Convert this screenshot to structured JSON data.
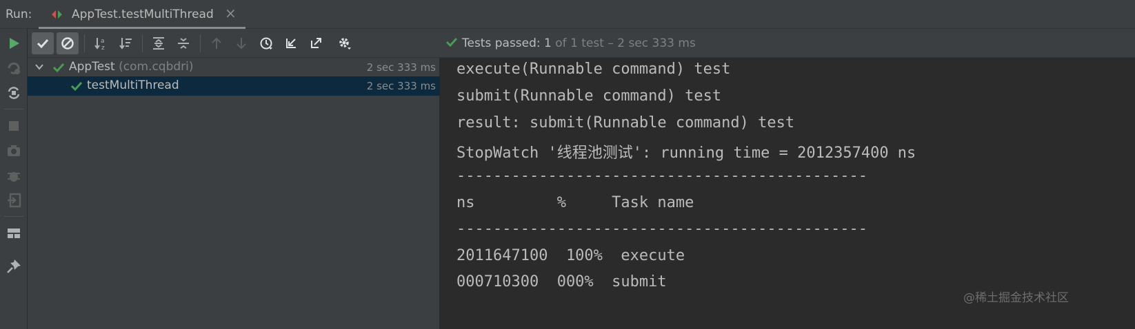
{
  "header": {
    "run_label": "Run:",
    "tab_title": "AppTest.testMultiThread",
    "tab_close": "×"
  },
  "left_toolbar": {
    "icons": [
      "rerun-icon",
      "rerun-failed-icon",
      "toggle-auto-test-icon",
      "stop-icon",
      "camera-icon",
      "debug-icon",
      "exit-icon",
      "layout-icon",
      "pin-icon"
    ]
  },
  "toolbar": {
    "icons": [
      "show-passed-icon",
      "show-ignored-icon",
      "sort-alphabetically-icon",
      "sort-by-duration-icon",
      "expand-all-icon",
      "collapse-all-icon",
      "previous-failed-icon",
      "next-failed-icon",
      "test-history-icon",
      "import-tests-icon",
      "export-results-icon",
      "settings-icon"
    ]
  },
  "status": {
    "prefix": "Tests passed: ",
    "count": "1",
    "suffix": " of 1 test – 2 sec 333 ms"
  },
  "tree": {
    "root": {
      "name": "AppTest",
      "package": "(com.cqbdri)",
      "time": "2 sec 333 ms"
    },
    "child": {
      "name": "testMultiThread",
      "time": "2 sec 333 ms"
    }
  },
  "console": {
    "lines": [
      "execute(Runnable command) test",
      "submit(Runnable command) test",
      "result: submit(Runnable command) test",
      "StopWatch '线程池测试': running time = 2012357400 ns",
      "---------------------------------------------",
      "ns         %     Task name",
      "---------------------------------------------",
      "2011647100  100%  execute",
      "000710300  000%  submit"
    ]
  },
  "watermark": "@稀土掘金技术社区",
  "colors": {
    "pass_green": "#499c54",
    "run_green": "#59a869",
    "selection": "#0d293e",
    "console_bg": "#2b2b2b",
    "panel_bg": "#3c3f41"
  }
}
